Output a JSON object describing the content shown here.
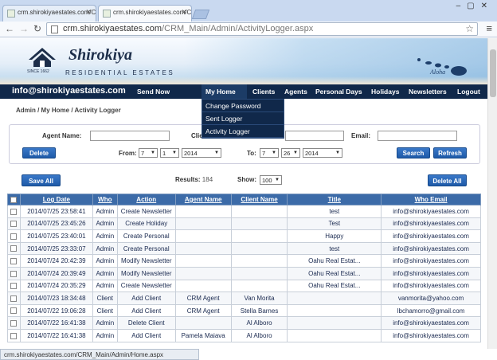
{
  "browser": {
    "tabs": [
      {
        "title": "crm.shirokiyaestates.com/CR"
      },
      {
        "title": "crm.shirokiyaestates.com/CR"
      }
    ],
    "url_host": "crm.shirokiyaestates.com",
    "url_path": "/CRM_Main/Admin/ActivityLogger.aspx",
    "status_url": "crm.shirokiyaestates.com/CRM_Main/Admin/Home.aspx"
  },
  "brand": {
    "name": "Shirokiya",
    "tagline": "RESIDENTIAL ESTATES",
    "since": "SINCE 1662",
    "aloha": "Aloha"
  },
  "nav": {
    "email": "info@shirokiyaestates.com",
    "send_now": "Send Now",
    "items": [
      "My Home",
      "Clients",
      "Agents",
      "Personal Days",
      "Holidays",
      "Newsletters",
      "Logout"
    ]
  },
  "dropdown": [
    "Change Password",
    "Sent Logger",
    "Activity Logger"
  ],
  "breadcrumb": "Admin / My Home / Activity Logger",
  "filters": {
    "agent_name_label": "Agent Name:",
    "client_label": "Clie",
    "email_label": "Email:",
    "from_label": "From:",
    "to_label": "To:",
    "from": {
      "month": "7",
      "day": "1",
      "year": "2014"
    },
    "to": {
      "month": "7",
      "day": "26",
      "year": "2014"
    }
  },
  "buttons": {
    "delete": "Delete",
    "search": "Search",
    "refresh": "Refresh",
    "save_all": "Save All",
    "delete_all": "Delete All"
  },
  "results": {
    "label": "Results:",
    "count": "184",
    "show_label": "Show:",
    "show_value": "100"
  },
  "table": {
    "headers": [
      "Log Date",
      "Who",
      "Action",
      "Agent Name",
      "Client Name",
      "Title",
      "Who Email"
    ],
    "rows": [
      [
        "2014/07/25 23:58:41",
        "Admin",
        "Create Newsletter",
        "",
        "",
        "test",
        "info@shirokiyaestates.com"
      ],
      [
        "2014/07/25 23:45:26",
        "Admin",
        "Create Holiday",
        "",
        "",
        "Test",
        "info@shirokiyaestates.com"
      ],
      [
        "2014/07/25 23:40:01",
        "Admin",
        "Create Personal",
        "",
        "",
        "Happy",
        "info@shirokiyaestates.com"
      ],
      [
        "2014/07/25 23:33:07",
        "Admin",
        "Create Personal",
        "",
        "",
        "test",
        "info@shirokiyaestates.com"
      ],
      [
        "2014/07/24 20:42:39",
        "Admin",
        "Modify Newsletter",
        "",
        "",
        "Oahu Real Estat...",
        "info@shirokiyaestates.com"
      ],
      [
        "2014/07/24 20:39:49",
        "Admin",
        "Modify Newsletter",
        "",
        "",
        "Oahu Real Estat...",
        "info@shirokiyaestates.com"
      ],
      [
        "2014/07/24 20:35:29",
        "Admin",
        "Create Newsletter",
        "",
        "",
        "Oahu Real Estat...",
        "info@shirokiyaestates.com"
      ],
      [
        "2014/07/23 18:34:48",
        "Client",
        "Add Client",
        "CRM Agent",
        "Van Morita",
        "",
        "vanmorita@yahoo.com"
      ],
      [
        "2014/07/22 19:06:28",
        "Client",
        "Add Client",
        "CRM Agent",
        "Stella Barnes",
        "",
        "lbchamorro@gmail.com"
      ],
      [
        "2014/07/22 16:41:38",
        "Admin",
        "Delete Client",
        "",
        "Al Alboro",
        "",
        "info@shirokiyaestates.com"
      ],
      [
        "2014/07/22 16:41:38",
        "Admin",
        "Add Client",
        "Pamela Maiava",
        "Al Alboro",
        "",
        "info@shirokiyaestates.com"
      ]
    ]
  }
}
